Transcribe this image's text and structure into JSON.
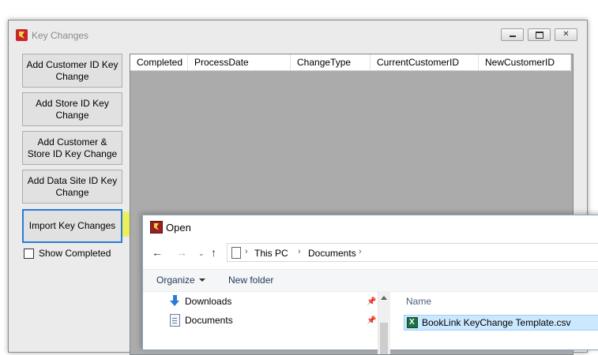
{
  "window": {
    "title": "Key Changes",
    "accent": "#2b7bd6",
    "highlight_color": "#ecf028"
  },
  "side_buttons": [
    {
      "label": "Add Customer ID Key Change"
    },
    {
      "label": "Add Store ID Key Change"
    },
    {
      "label": "Add Customer & Store ID Key Change"
    },
    {
      "label": "Add Data Site ID Key Change"
    },
    {
      "label": "Import Key Changes"
    }
  ],
  "show_completed": {
    "label": "Show Completed",
    "checked": false
  },
  "grid": {
    "columns": [
      "Completed",
      "ProcessDate",
      "ChangeType",
      "CurrentCustomerID",
      "NewCustomerID"
    ]
  },
  "open_dialog": {
    "title": "Open",
    "breadcrumb": [
      "This PC",
      "Documents"
    ],
    "toolbar": {
      "organize": "Organize",
      "new_folder": "New folder"
    },
    "nav_items": [
      {
        "label": "Downloads",
        "icon": "download-icon"
      },
      {
        "label": "Documents",
        "icon": "document-icon"
      }
    ],
    "list_header": "Name",
    "files": [
      {
        "name": "BookLink KeyChange Template.csv",
        "icon": "excel-file-icon",
        "selected": true
      }
    ]
  }
}
